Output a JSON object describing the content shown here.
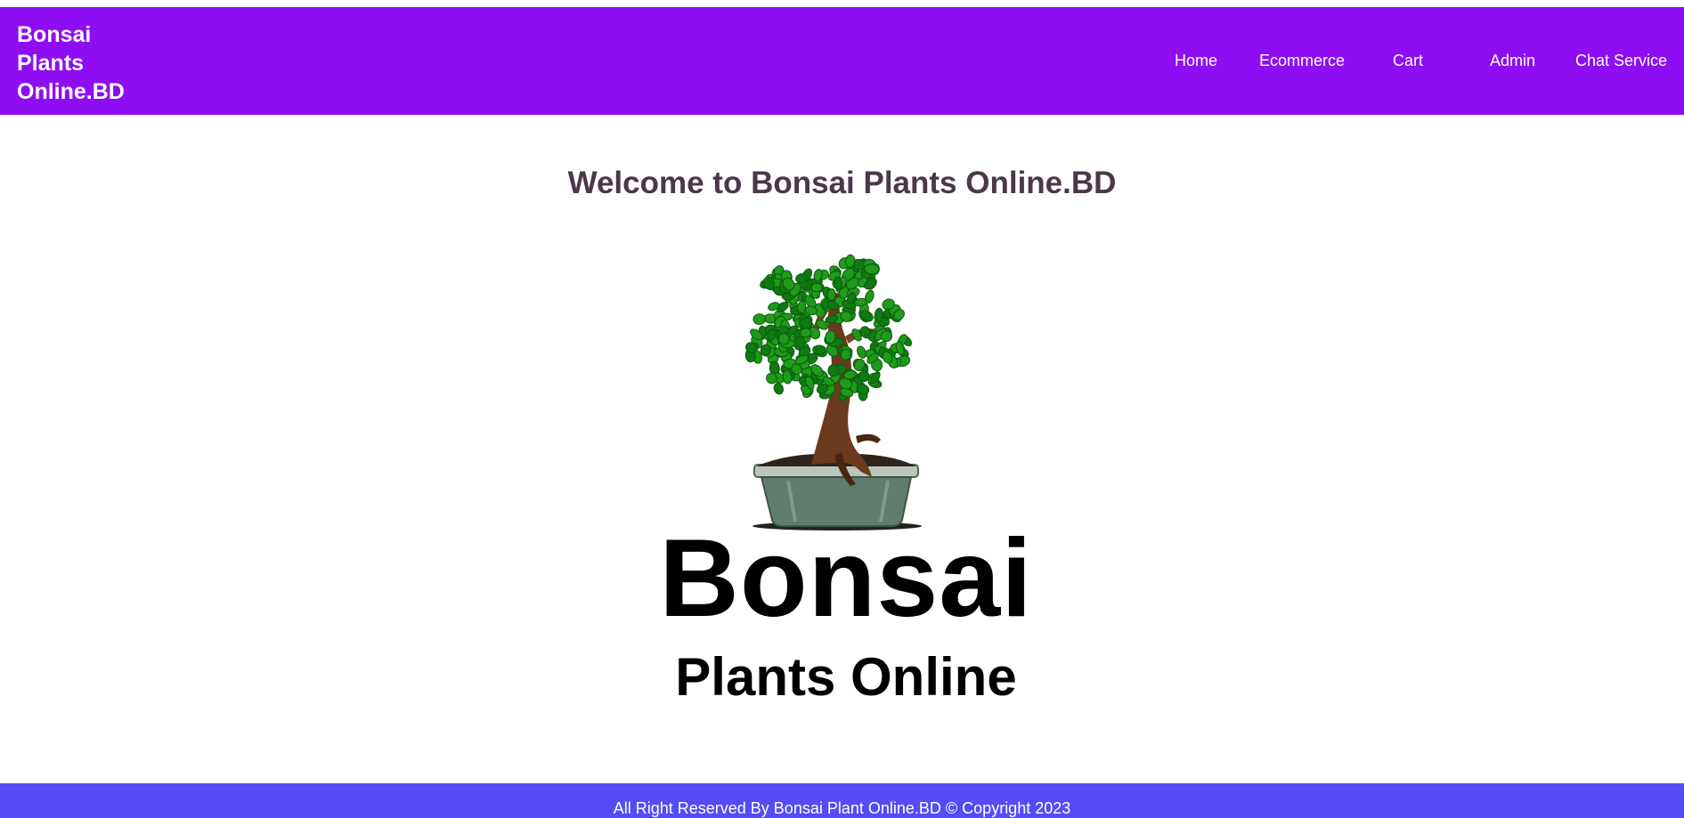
{
  "header": {
    "brand": "Bonsai Plants Online.BD",
    "nav": [
      {
        "label": "Home"
      },
      {
        "label": "Ecommerce"
      },
      {
        "label": "Cart"
      },
      {
        "label": "Admin"
      },
      {
        "label": "Chat Service"
      }
    ]
  },
  "main": {
    "welcome": "Welcome to Bonsai Plants Online.BD",
    "logo": {
      "icon": "bonsai-tree-in-pot",
      "line1": "Bonsai",
      "line2": "Plants Online"
    }
  },
  "footer": {
    "text": "All Right Reserved By Bonsai Plant Online.BD © Copyright 2023"
  },
  "colors": {
    "header_bg": "#8f0df2",
    "footer_bg": "#544cf5",
    "heading_text": "#4a3848",
    "leaf_green": "#1f9a1a",
    "trunk_brown": "#6b3a1c",
    "pot_green": "#5f7d6c"
  }
}
